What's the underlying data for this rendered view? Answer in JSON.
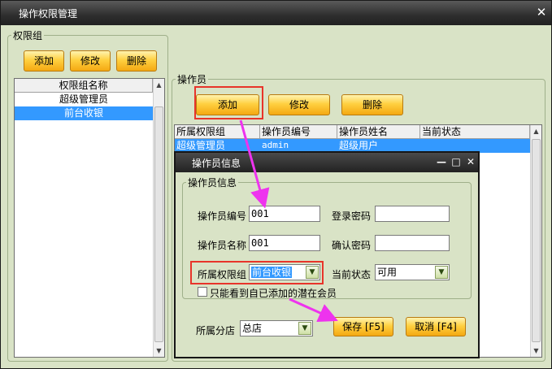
{
  "window": {
    "title": "操作权限管理",
    "close_label": "✕"
  },
  "perm_group": {
    "legend": "权限组",
    "add_label": "添加",
    "edit_label": "修改",
    "delete_label": "删除",
    "column_header": "权限组名称",
    "items": [
      "超级管理员",
      "前台收银"
    ]
  },
  "operator_panel": {
    "legend": "操作员",
    "add_label": "添加",
    "edit_label": "修改",
    "delete_label": "删除",
    "columns": [
      "所属权限组",
      "操作员编号",
      "操作员姓名",
      "当前状态"
    ],
    "rows": [
      {
        "group": "超级管理员",
        "id": "admin",
        "name": "超级用户",
        "status": ""
      }
    ]
  },
  "dialog": {
    "title": "操作员信息",
    "min_label": "—",
    "max_label": "□",
    "close_label": "✕",
    "legend": "操作员信息",
    "operator_id_label": "操作员编号",
    "operator_id_value": "001",
    "login_pwd_label": "登录密码",
    "login_pwd_value": "",
    "operator_name_label": "操作员名称",
    "operator_name_value": "001",
    "confirm_pwd_label": "确认密码",
    "confirm_pwd_value": "",
    "group_label": "所属权限组",
    "group_value": "前台收银",
    "status_label": "当前状态",
    "status_value": "可用",
    "checkbox_label": "只能看到自已添加的潜在会员",
    "branch_label": "所属分店",
    "branch_value": "总店",
    "save_label": "保存 [F5]",
    "cancel_label": "取消 [F4]"
  },
  "colors": {
    "accent_button": "#ffd040",
    "selection": "#3399ff",
    "annotation_red": "#e8342a",
    "annotation_arrow": "#ee33ee"
  },
  "icons": {
    "scroll_up": "▲",
    "scroll_down": "▼",
    "dropdown": "▼"
  }
}
